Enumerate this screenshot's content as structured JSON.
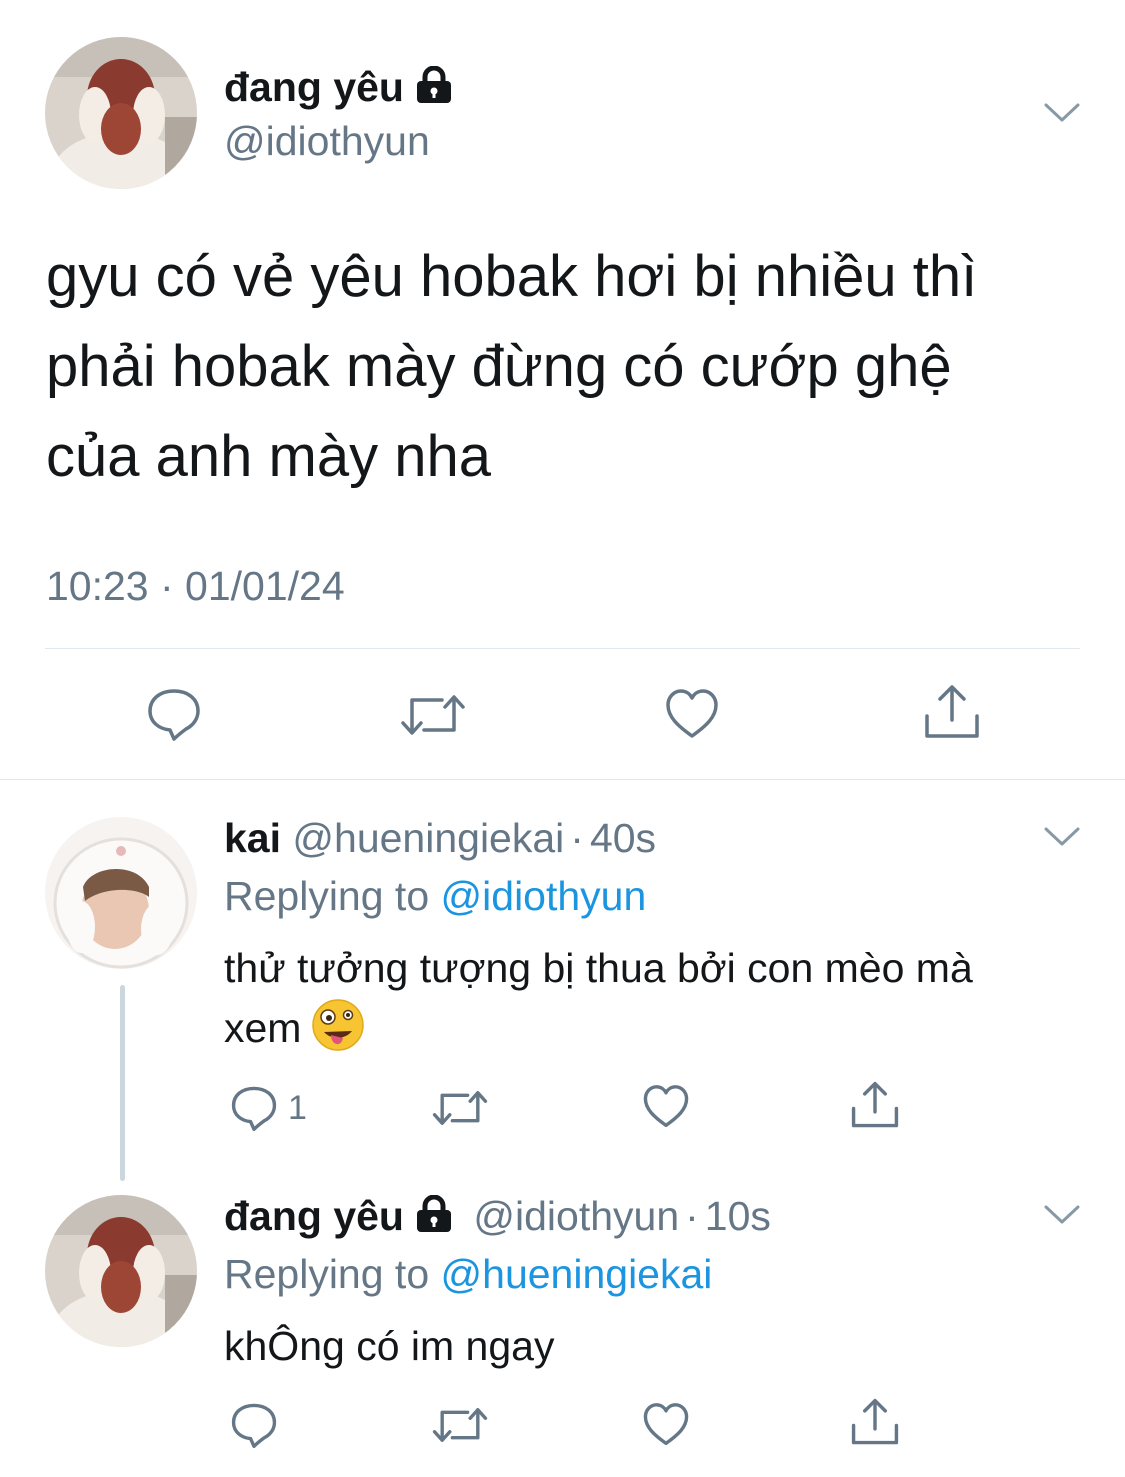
{
  "main_tweet": {
    "display_name": "đang yêu",
    "handle": "@idiothyun",
    "text_line1": "gyu có vẻ yêu hobak hơi bị nhiều thì",
    "text_line2": "phải hobak mày đừng có cướp ghệ",
    "text_line3": "của anh mày nha",
    "timestamp": "10:23 · 01/01/24"
  },
  "reply1": {
    "display_name": "kai",
    "handle": "@hueningiekai",
    "time": "40s",
    "replying_prefix": "Replying to",
    "replying_to": "@idiothyun",
    "text_line1": "thử tưởng tượng bị thua bởi con mèo mà",
    "text_line2": "xem",
    "reply_count": "1"
  },
  "reply2": {
    "display_name": "đang yêu",
    "handle": "@idiothyun",
    "time": "10s",
    "replying_prefix": "Replying to",
    "replying_to": "@hueningiekai",
    "text": "khÔng có im ngay"
  },
  "icons": {
    "reply": "speech-bubble-icon",
    "retweet": "retweet-icon",
    "like": "heart-icon",
    "share": "share-icon",
    "lock": "lock-icon",
    "menu": "chevron-down-icon",
    "emoji": "zany-face-emoji"
  },
  "colors": {
    "text": "#14171a",
    "secondary": "#657786",
    "link": "#1b95e0",
    "divider": "#e1e8ed",
    "thread_line": "#ccd6dd"
  }
}
